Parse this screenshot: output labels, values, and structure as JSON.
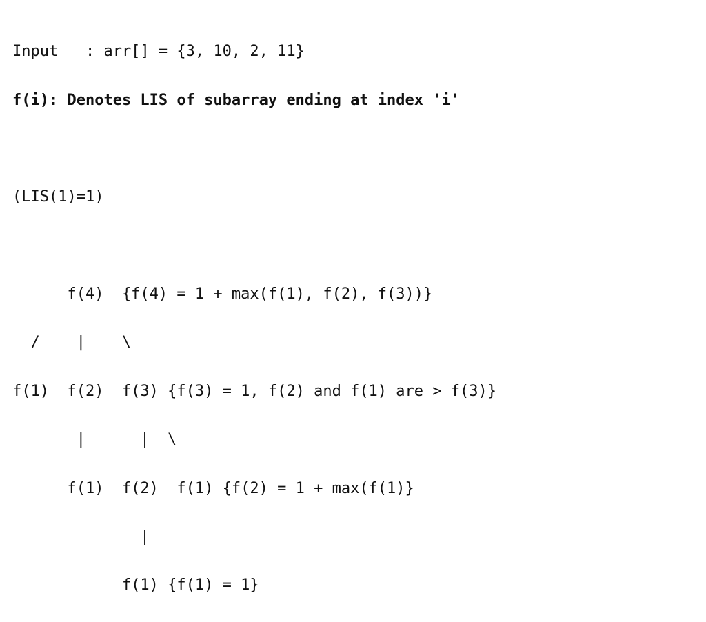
{
  "lines": {
    "l1": "Input   : arr[] = {3, 10, 2, 11}",
    "l2": "f(i): Denotes LIS of subarray ending at index 'i'",
    "l3": "",
    "l4": "(LIS(1)=1)",
    "l5": "",
    "l6": "      f(4)  {f(4) = 1 + max(f(1), f(2), f(3))}",
    "l7": "  /    |    \\",
    "l8": "f(1)  f(2)  f(3) {f(3) = 1, f(2) and f(1) are > f(3)}",
    "l9": "       |      |  \\",
    "l10": "      f(1)  f(2)  f(1) {f(2) = 1 + max(f(1)}",
    "l11": "              |",
    "l12": "            f(1) {f(1) = 1}"
  }
}
